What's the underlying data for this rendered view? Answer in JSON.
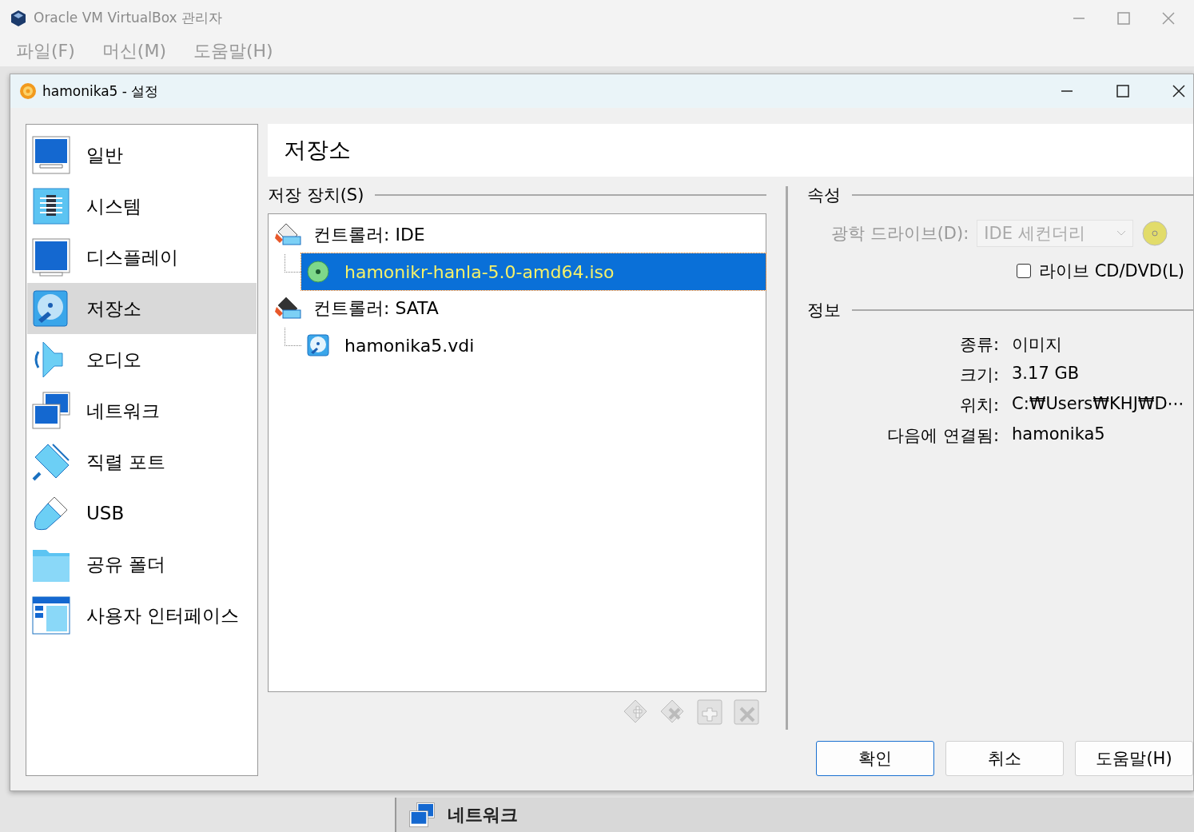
{
  "manager": {
    "title": "Oracle VM VirtualBox 관리자",
    "menu": [
      "파일(F)",
      "머신(M)",
      "도움말(H)"
    ],
    "bottom_section": "네트워크"
  },
  "dialog": {
    "title": "hamonika5 - 설정",
    "sidebar": [
      {
        "kind": "general",
        "label": "일반",
        "selected": false
      },
      {
        "kind": "system",
        "label": "시스템",
        "selected": false
      },
      {
        "kind": "display",
        "label": "디스플레이",
        "selected": false
      },
      {
        "kind": "storage",
        "label": "저장소",
        "selected": true
      },
      {
        "kind": "audio",
        "label": "오디오",
        "selected": false
      },
      {
        "kind": "network",
        "label": "네트워크",
        "selected": false
      },
      {
        "kind": "serial",
        "label": "직렬 포트",
        "selected": false
      },
      {
        "kind": "usb",
        "label": "USB",
        "selected": false
      },
      {
        "kind": "shared",
        "label": "공유 폴더",
        "selected": false
      },
      {
        "kind": "ui",
        "label": "사용자 인터페이스",
        "selected": false
      }
    ],
    "page_title": "저장소",
    "storage": {
      "heading": "저장 장치(S)",
      "tree": [
        {
          "kind": "ide",
          "label": "컨트롤러: IDE",
          "children": [
            {
              "kind": "optical",
              "label": "hamonikr-hanla-5.0-amd64.iso",
              "selected": true
            }
          ]
        },
        {
          "kind": "sata",
          "label": "컨트롤러: SATA",
          "children": [
            {
              "kind": "disk",
              "label": "hamonika5.vdi",
              "selected": false
            }
          ]
        }
      ]
    },
    "attributes": {
      "heading": "속성",
      "drive_label": "광학 드라이브(D):",
      "drive_value": "IDE 세컨더리",
      "live_cd": {
        "label": "라이브 CD/DVD(L)",
        "checked": false
      }
    },
    "info": {
      "heading": "정보",
      "rows": [
        {
          "label": "종류:",
          "value": "이미지"
        },
        {
          "label": "크기:",
          "value": "3.17  GB"
        },
        {
          "label": "위치:",
          "value": "C:₩Users₩KHJ₩D⋯"
        },
        {
          "label": "다음에 연결됨:",
          "value": "hamonika5"
        }
      ]
    },
    "buttons": [
      {
        "label": "확인",
        "default": true
      },
      {
        "label": "취소",
        "default": false
      },
      {
        "label": "도움말(H)",
        "default": false
      }
    ]
  }
}
